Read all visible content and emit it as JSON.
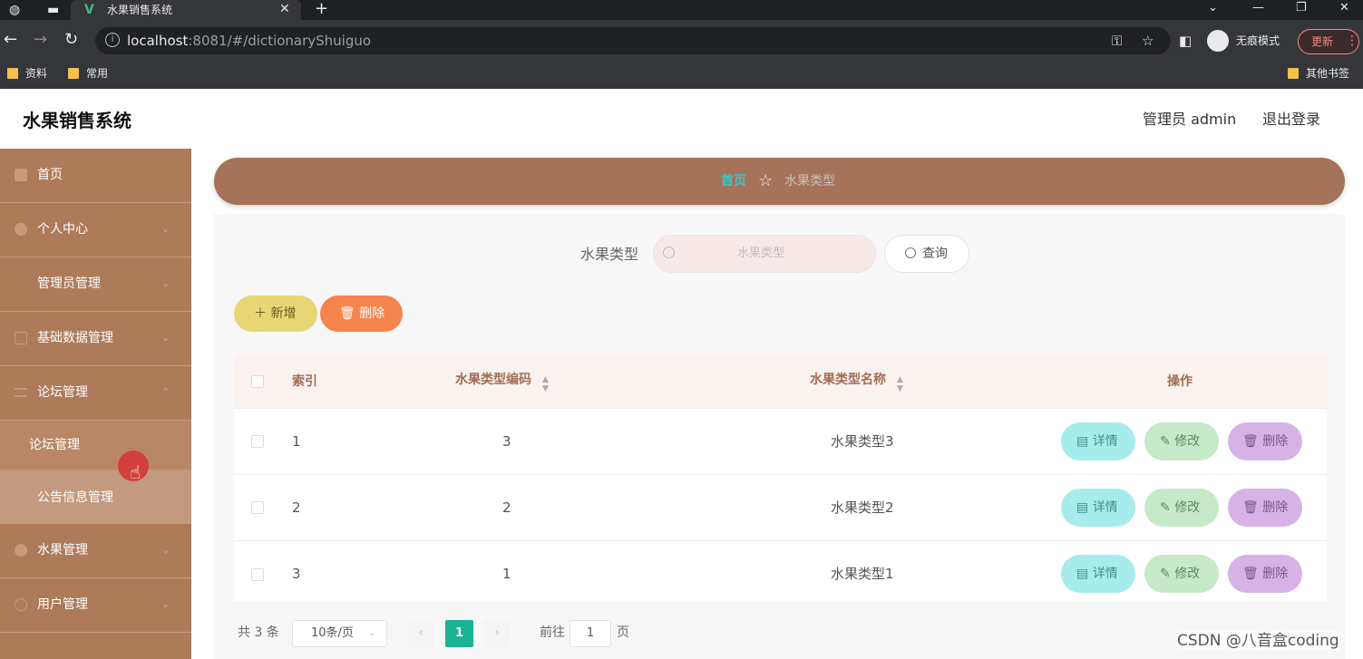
{
  "browser": {
    "tab_title": "水果销售系统",
    "url_host": "localhost",
    "url_rest": ":8081/#/dictionaryShuiguo",
    "incognito_label": "无痕模式",
    "update_label": "更新",
    "bookmarks": [
      "资料",
      "常用"
    ],
    "other_bookmarks": "其他书签"
  },
  "header": {
    "title": "水果销售系统",
    "user": "管理员 admin",
    "logout": "退出登录"
  },
  "sidebar": {
    "items": [
      {
        "label": "首页"
      },
      {
        "label": "个人中心"
      },
      {
        "label": "管理员管理"
      },
      {
        "label": "基础数据管理"
      },
      {
        "label": "论坛管理"
      },
      {
        "label": "水果管理"
      },
      {
        "label": "用户管理"
      }
    ],
    "submenu": [
      {
        "label": "论坛管理"
      },
      {
        "label": "公告信息管理"
      }
    ]
  },
  "breadcrumb": {
    "home": "首页",
    "current": "水果类型"
  },
  "search": {
    "label": "水果类型",
    "placeholder": "水果类型",
    "button": "查询"
  },
  "actions": {
    "add": "新增",
    "delete": "删除"
  },
  "table": {
    "columns": [
      "索引",
      "水果类型编码",
      "水果类型名称",
      "操作"
    ],
    "rows": [
      {
        "index": "1",
        "code": "3",
        "name": "水果类型3"
      },
      {
        "index": "2",
        "code": "2",
        "name": "水果类型2"
      },
      {
        "index": "3",
        "code": "1",
        "name": "水果类型1"
      }
    ],
    "row_actions": {
      "detail": "详情",
      "edit": "修改",
      "delete": "删除"
    }
  },
  "pagination": {
    "total": "共 3 条",
    "page_size": "10条/页",
    "current_page": "1",
    "goto_label": "前往",
    "goto_value": "1",
    "page_unit": "页"
  },
  "watermark": "CSDN @八音盒coding",
  "colors": {
    "sidebar": "#ad7b5a",
    "breadcrumb_bar": "#a5725a",
    "accent_teal": "#1ab394",
    "add_button": "#e8d574",
    "delete_button": "#f5844d",
    "detail_button": "#a6ecec",
    "edit_button": "#c6e9c8",
    "row_delete_button": "#d6b2e6"
  }
}
